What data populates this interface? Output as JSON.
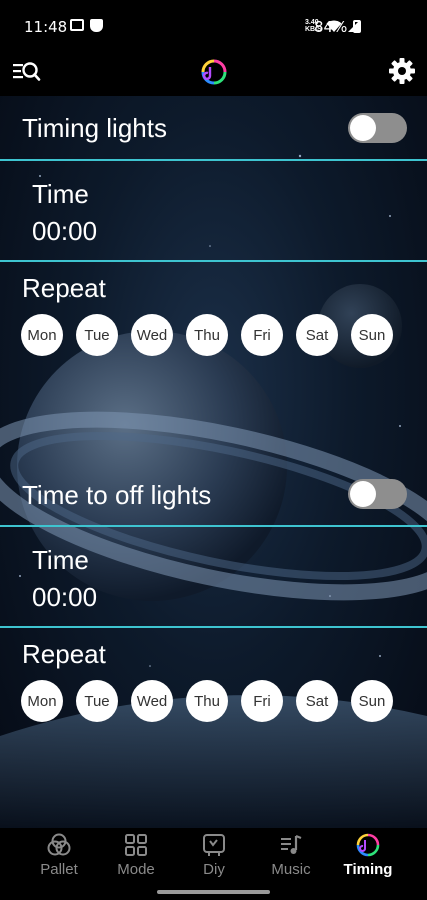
{
  "status_bar": {
    "time": "11:48",
    "speed_top": "3.40",
    "speed_bottom": "KB/S",
    "battery": "84%"
  },
  "header": {
    "left_icon": "menu-search-icon",
    "logo_icon": "app-logo-icon",
    "right_icon": "gear-icon"
  },
  "timing_on": {
    "label": "Timing lights",
    "toggle_on": false,
    "time_label": "Time",
    "time_value": "00:00",
    "repeat_label": "Repeat",
    "days": [
      "Mon",
      "Tue",
      "Wed",
      "Thu",
      "Fri",
      "Sat",
      "Sun"
    ]
  },
  "timing_off": {
    "label": "Time to off lights",
    "toggle_on": false,
    "time_label": "Time",
    "time_value": "00:00",
    "repeat_label": "Repeat",
    "days": [
      "Mon",
      "Tue",
      "Wed",
      "Thu",
      "Fri",
      "Sat",
      "Sun"
    ]
  },
  "nav": {
    "items": [
      {
        "label": "Pallet",
        "icon": "pallet-icon",
        "active": false
      },
      {
        "label": "Mode",
        "icon": "mode-grid-icon",
        "active": false
      },
      {
        "label": "Diy",
        "icon": "diy-icon",
        "active": false
      },
      {
        "label": "Music",
        "icon": "music-icon",
        "active": false
      },
      {
        "label": "Timing",
        "icon": "timing-icon",
        "active": true
      }
    ]
  },
  "colors": {
    "divider": "#3ec4d0",
    "toggle_off": "#8e8e8e",
    "nav_active": "#ffffff",
    "nav_inactive": "#8a8a8a"
  }
}
